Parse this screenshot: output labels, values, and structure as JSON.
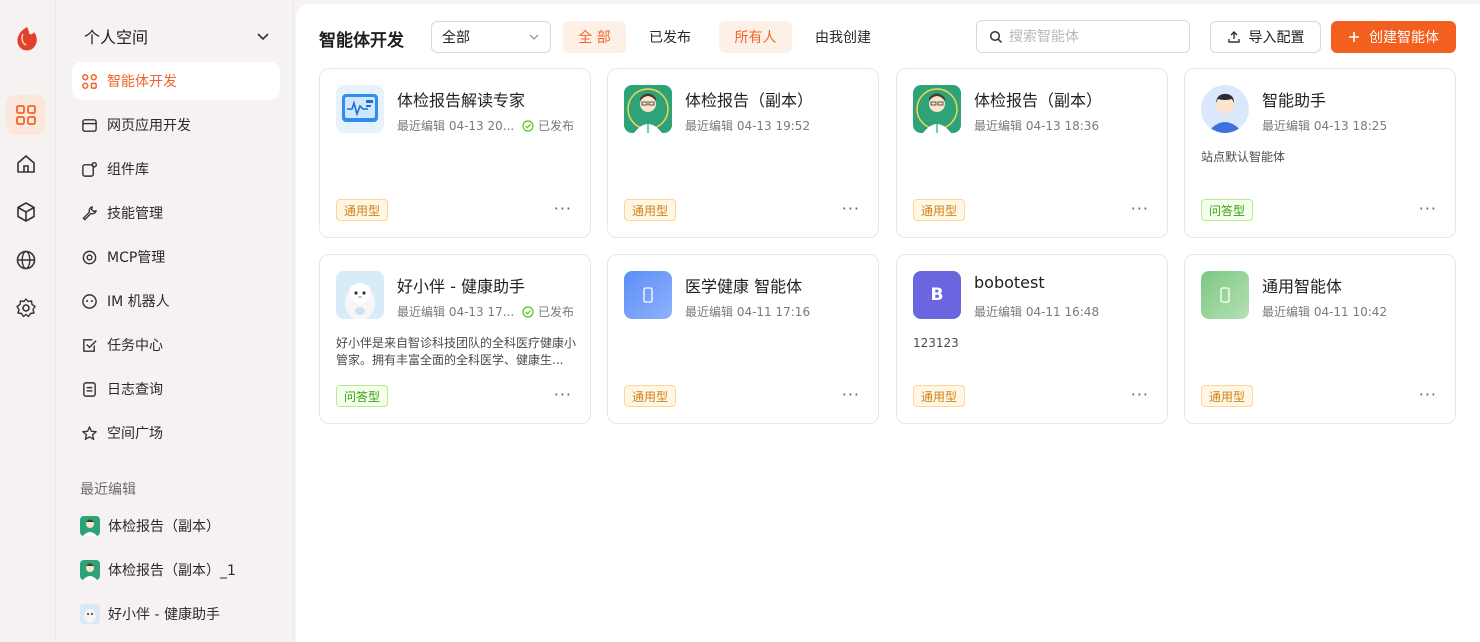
{
  "rail": {
    "items": [
      {
        "icon": "grid-icon",
        "active": true
      },
      {
        "icon": "home-icon",
        "active": false
      },
      {
        "icon": "cube-icon",
        "active": false
      },
      {
        "icon": "globe-icon",
        "active": false
      },
      {
        "icon": "gear-icon",
        "active": false
      }
    ]
  },
  "sidebar": {
    "space_label": "个人空间",
    "items": [
      {
        "label": "智能体开发",
        "icon": "apps-icon",
        "active": true
      },
      {
        "label": "网页应用开发",
        "icon": "window-icon",
        "active": false
      },
      {
        "label": "组件库",
        "icon": "component-icon",
        "active": false
      },
      {
        "label": "技能管理",
        "icon": "wrench-icon",
        "active": false
      },
      {
        "label": "MCP管理",
        "icon": "target-icon",
        "active": false
      },
      {
        "label": "IM 机器人",
        "icon": "robot-icon",
        "active": false
      },
      {
        "label": "任务中心",
        "icon": "checklist-icon",
        "active": false
      },
      {
        "label": "日志查询",
        "icon": "document-icon",
        "active": false
      },
      {
        "label": "空间广场",
        "icon": "star-icon",
        "active": false
      }
    ],
    "recent_title": "最近编辑",
    "recent": [
      {
        "label": "体检报告（副本）",
        "thumb": "doctor"
      },
      {
        "label": "体检报告（副本）_1",
        "thumb": "doctor"
      },
      {
        "label": "好小伴 - 健康助手",
        "thumb": "mascot"
      }
    ]
  },
  "header": {
    "title": "智能体开发",
    "filter_select": "全部",
    "tabs_status": [
      {
        "label": "全 部",
        "active": true
      },
      {
        "label": "已发布",
        "active": false
      }
    ],
    "tabs_owner": [
      {
        "label": "所有人",
        "active": true
      },
      {
        "label": "由我创建",
        "active": false
      }
    ],
    "search_placeholder": "搜索智能体",
    "import_label": "导入配置",
    "create_label": "创建智能体"
  },
  "colors": {
    "accent": "#f35f1f",
    "active_bg": "#fdf0e6"
  },
  "cards": [
    {
      "name": "体检报告解读专家",
      "meta": "最近编辑 04-13 20...",
      "status": "已发布",
      "desc": "",
      "tag": "通用型",
      "tag_type": "general",
      "avatar": "monitor"
    },
    {
      "name": "体检报告（副本）",
      "meta": "最近编辑 04-13 19:52",
      "status": "",
      "desc": "",
      "tag": "通用型",
      "tag_type": "general",
      "avatar": "doctor"
    },
    {
      "name": "体检报告（副本）",
      "meta": "最近编辑 04-13 18:36",
      "status": "",
      "desc": "",
      "tag": "通用型",
      "tag_type": "general",
      "avatar": "doctor"
    },
    {
      "name": "智能助手",
      "meta": "最近编辑 04-13 18:25",
      "status": "",
      "desc": "站点默认智能体",
      "tag": "问答型",
      "tag_type": "qa",
      "avatar": "person"
    },
    {
      "name": "好小伴 - 健康助手",
      "meta": "最近编辑 04-13 17...",
      "status": "已发布",
      "desc": "好小伴是来自智诊科技团队的全科医疗健康小管家。拥有丰富全面的全科医学、健康生...",
      "tag": "问答型",
      "tag_type": "qa",
      "avatar": "mascot"
    },
    {
      "name": "医学健康 智能体",
      "meta": "最近编辑 04-11 17:16",
      "status": "",
      "desc": "",
      "tag": "通用型",
      "tag_type": "general",
      "avatar": "blue"
    },
    {
      "name": "bobotest",
      "meta": "最近编辑 04-11 16:48",
      "status": "",
      "desc": "123123",
      "tag": "通用型",
      "tag_type": "general",
      "avatar": "letter",
      "avatar_letter": "B"
    },
    {
      "name": "通用智能体",
      "meta": "最近编辑 04-11 10:42",
      "status": "",
      "desc": "",
      "tag": "通用型",
      "tag_type": "general",
      "avatar": "green"
    }
  ]
}
